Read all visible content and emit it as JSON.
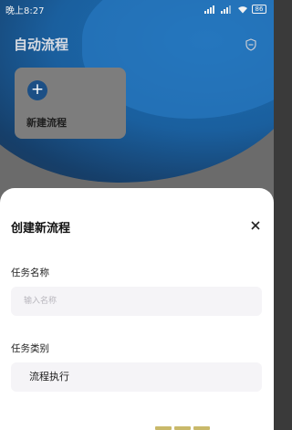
{
  "status_bar": {
    "time": "晚上8:27",
    "battery": "86"
  },
  "background": {
    "page_title": "自动流程",
    "new_card": {
      "label": "新建流程",
      "icon": "plus-icon"
    },
    "top_right_icon": "shield-icon"
  },
  "sheet": {
    "title": "创建新流程",
    "close_icon": "close-icon",
    "name_field": {
      "label": "任务名称",
      "placeholder": "输入名称",
      "value": ""
    },
    "type_field": {
      "label": "任务类别",
      "value": "流程执行"
    }
  },
  "colors": {
    "accent_blue": "#1c4f85",
    "sheet_bg": "#ffffff",
    "input_bg": "#f5f4f7"
  }
}
